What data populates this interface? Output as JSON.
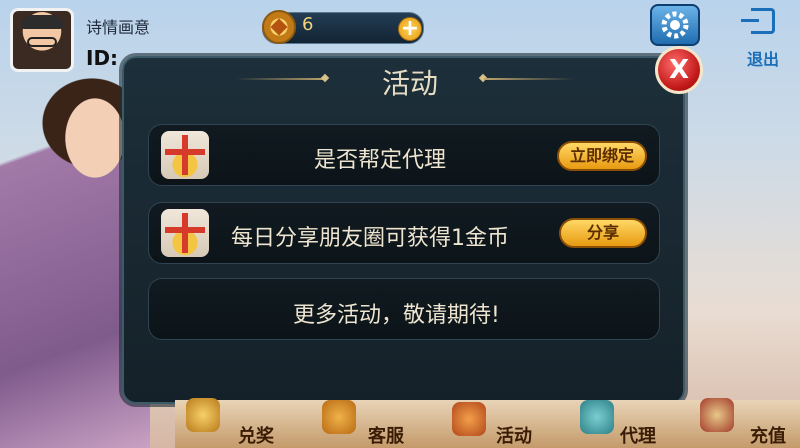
{
  "user": {
    "name": "诗情画意",
    "id_label": "ID:"
  },
  "coins": {
    "value": "6",
    "add_icon": "plus-icon"
  },
  "topbar": {
    "settings_icon": "gear-icon",
    "exit_label": "退出",
    "exit_icon": "exit-icon"
  },
  "dialog": {
    "title": "活动",
    "close_label": "X",
    "items": [
      {
        "text": "是否帮定代理",
        "button": "立即绑定",
        "icon": "gift-icon"
      },
      {
        "text": "每日分享朋友圈可获得1金币",
        "button": "分享",
        "icon": "gift-icon"
      },
      {
        "text": "更多活动，敬请期待!"
      }
    ]
  },
  "nav": {
    "items": [
      {
        "label": "兑奖",
        "icon": "redeem-icon"
      },
      {
        "label": "客服",
        "icon": "service-icon"
      },
      {
        "label": "活动",
        "icon": "activity-icon"
      },
      {
        "label": "代理",
        "icon": "agent-icon"
      },
      {
        "label": "充值",
        "icon": "recharge-icon"
      }
    ]
  },
  "colors": {
    "accent_gold": "#e89a10",
    "panel": "#152129",
    "close_red": "#c21919",
    "exit_blue": "#1b6fb8"
  }
}
